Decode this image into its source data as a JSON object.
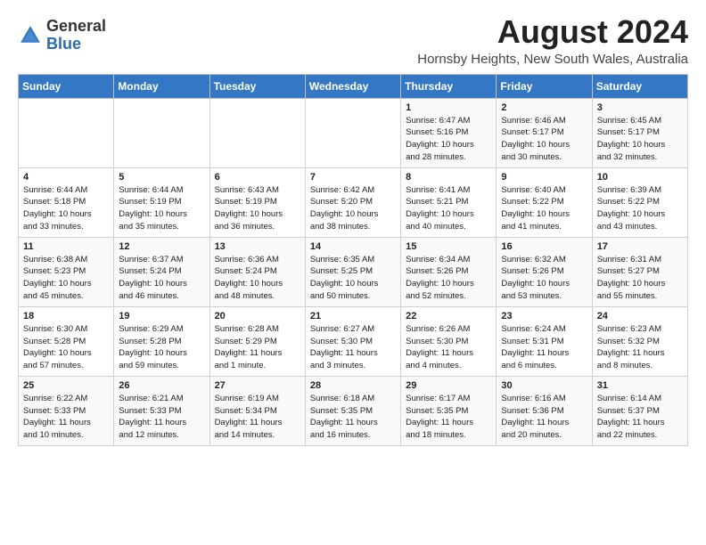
{
  "header": {
    "logo_general": "General",
    "logo_blue": "Blue",
    "main_title": "August 2024",
    "subtitle": "Hornsby Heights, New South Wales, Australia"
  },
  "calendar": {
    "weekdays": [
      "Sunday",
      "Monday",
      "Tuesday",
      "Wednesday",
      "Thursday",
      "Friday",
      "Saturday"
    ],
    "weeks": [
      [
        {
          "day": "",
          "info": ""
        },
        {
          "day": "",
          "info": ""
        },
        {
          "day": "",
          "info": ""
        },
        {
          "day": "",
          "info": ""
        },
        {
          "day": "1",
          "info": "Sunrise: 6:47 AM\nSunset: 5:16 PM\nDaylight: 10 hours\nand 28 minutes."
        },
        {
          "day": "2",
          "info": "Sunrise: 6:46 AM\nSunset: 5:17 PM\nDaylight: 10 hours\nand 30 minutes."
        },
        {
          "day": "3",
          "info": "Sunrise: 6:45 AM\nSunset: 5:17 PM\nDaylight: 10 hours\nand 32 minutes."
        }
      ],
      [
        {
          "day": "4",
          "info": "Sunrise: 6:44 AM\nSunset: 5:18 PM\nDaylight: 10 hours\nand 33 minutes."
        },
        {
          "day": "5",
          "info": "Sunrise: 6:44 AM\nSunset: 5:19 PM\nDaylight: 10 hours\nand 35 minutes."
        },
        {
          "day": "6",
          "info": "Sunrise: 6:43 AM\nSunset: 5:19 PM\nDaylight: 10 hours\nand 36 minutes."
        },
        {
          "day": "7",
          "info": "Sunrise: 6:42 AM\nSunset: 5:20 PM\nDaylight: 10 hours\nand 38 minutes."
        },
        {
          "day": "8",
          "info": "Sunrise: 6:41 AM\nSunset: 5:21 PM\nDaylight: 10 hours\nand 40 minutes."
        },
        {
          "day": "9",
          "info": "Sunrise: 6:40 AM\nSunset: 5:22 PM\nDaylight: 10 hours\nand 41 minutes."
        },
        {
          "day": "10",
          "info": "Sunrise: 6:39 AM\nSunset: 5:22 PM\nDaylight: 10 hours\nand 43 minutes."
        }
      ],
      [
        {
          "day": "11",
          "info": "Sunrise: 6:38 AM\nSunset: 5:23 PM\nDaylight: 10 hours\nand 45 minutes."
        },
        {
          "day": "12",
          "info": "Sunrise: 6:37 AM\nSunset: 5:24 PM\nDaylight: 10 hours\nand 46 minutes."
        },
        {
          "day": "13",
          "info": "Sunrise: 6:36 AM\nSunset: 5:24 PM\nDaylight: 10 hours\nand 48 minutes."
        },
        {
          "day": "14",
          "info": "Sunrise: 6:35 AM\nSunset: 5:25 PM\nDaylight: 10 hours\nand 50 minutes."
        },
        {
          "day": "15",
          "info": "Sunrise: 6:34 AM\nSunset: 5:26 PM\nDaylight: 10 hours\nand 52 minutes."
        },
        {
          "day": "16",
          "info": "Sunrise: 6:32 AM\nSunset: 5:26 PM\nDaylight: 10 hours\nand 53 minutes."
        },
        {
          "day": "17",
          "info": "Sunrise: 6:31 AM\nSunset: 5:27 PM\nDaylight: 10 hours\nand 55 minutes."
        }
      ],
      [
        {
          "day": "18",
          "info": "Sunrise: 6:30 AM\nSunset: 5:28 PM\nDaylight: 10 hours\nand 57 minutes."
        },
        {
          "day": "19",
          "info": "Sunrise: 6:29 AM\nSunset: 5:28 PM\nDaylight: 10 hours\nand 59 minutes."
        },
        {
          "day": "20",
          "info": "Sunrise: 6:28 AM\nSunset: 5:29 PM\nDaylight: 11 hours\nand 1 minute."
        },
        {
          "day": "21",
          "info": "Sunrise: 6:27 AM\nSunset: 5:30 PM\nDaylight: 11 hours\nand 3 minutes."
        },
        {
          "day": "22",
          "info": "Sunrise: 6:26 AM\nSunset: 5:30 PM\nDaylight: 11 hours\nand 4 minutes."
        },
        {
          "day": "23",
          "info": "Sunrise: 6:24 AM\nSunset: 5:31 PM\nDaylight: 11 hours\nand 6 minutes."
        },
        {
          "day": "24",
          "info": "Sunrise: 6:23 AM\nSunset: 5:32 PM\nDaylight: 11 hours\nand 8 minutes."
        }
      ],
      [
        {
          "day": "25",
          "info": "Sunrise: 6:22 AM\nSunset: 5:33 PM\nDaylight: 11 hours\nand 10 minutes."
        },
        {
          "day": "26",
          "info": "Sunrise: 6:21 AM\nSunset: 5:33 PM\nDaylight: 11 hours\nand 12 minutes."
        },
        {
          "day": "27",
          "info": "Sunrise: 6:19 AM\nSunset: 5:34 PM\nDaylight: 11 hours\nand 14 minutes."
        },
        {
          "day": "28",
          "info": "Sunrise: 6:18 AM\nSunset: 5:35 PM\nDaylight: 11 hours\nand 16 minutes."
        },
        {
          "day": "29",
          "info": "Sunrise: 6:17 AM\nSunset: 5:35 PM\nDaylight: 11 hours\nand 18 minutes."
        },
        {
          "day": "30",
          "info": "Sunrise: 6:16 AM\nSunset: 5:36 PM\nDaylight: 11 hours\nand 20 minutes."
        },
        {
          "day": "31",
          "info": "Sunrise: 6:14 AM\nSunset: 5:37 PM\nDaylight: 11 hours\nand 22 minutes."
        }
      ]
    ]
  }
}
